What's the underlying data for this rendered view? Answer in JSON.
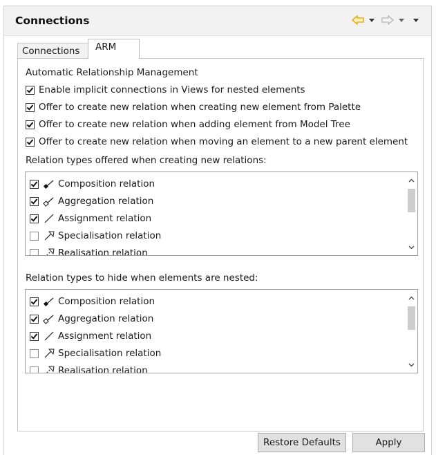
{
  "header": {
    "title": "Connections"
  },
  "tabs": [
    {
      "label": "Connections"
    },
    {
      "label": "ARM"
    }
  ],
  "arm": {
    "section_title": "Automatic Relationship Management",
    "options": [
      {
        "label": "Enable implicit connections in Views for nested elements",
        "checked": true
      },
      {
        "label": "Offer to create new relation when creating new element from Palette",
        "checked": true
      },
      {
        "label": "Offer to create new relation when adding element from Model Tree",
        "checked": true
      },
      {
        "label": "Offer to create new relation when moving an element to a new parent element",
        "checked": true
      }
    ],
    "offered_label": "Relation types offered when creating new relations:",
    "offered_list": [
      {
        "label": "Composition relation",
        "checked": true,
        "icon": "composition-icon"
      },
      {
        "label": "Aggregation relation",
        "checked": true,
        "icon": "aggregation-icon"
      },
      {
        "label": "Assignment relation",
        "checked": true,
        "icon": "assignment-icon"
      },
      {
        "label": "Specialisation relation",
        "checked": false,
        "icon": "specialisation-icon"
      },
      {
        "label": "Realisation relation",
        "checked": false,
        "icon": "realisation-icon"
      }
    ],
    "hide_label": "Relation types to hide when elements are nested:",
    "hide_list": [
      {
        "label": "Composition relation",
        "checked": true,
        "icon": "composition-icon"
      },
      {
        "label": "Aggregation relation",
        "checked": true,
        "icon": "aggregation-icon"
      },
      {
        "label": "Assignment relation",
        "checked": true,
        "icon": "assignment-icon"
      },
      {
        "label": "Specialisation relation",
        "checked": false,
        "icon": "specialisation-icon"
      },
      {
        "label": "Realisation relation",
        "checked": false,
        "icon": "realisation-icon"
      }
    ]
  },
  "buttons": {
    "restore": "Restore Defaults",
    "apply": "Apply"
  },
  "colors": {
    "back_arrow": "#f2b705",
    "forward_arrow": "#c8c8c8"
  }
}
